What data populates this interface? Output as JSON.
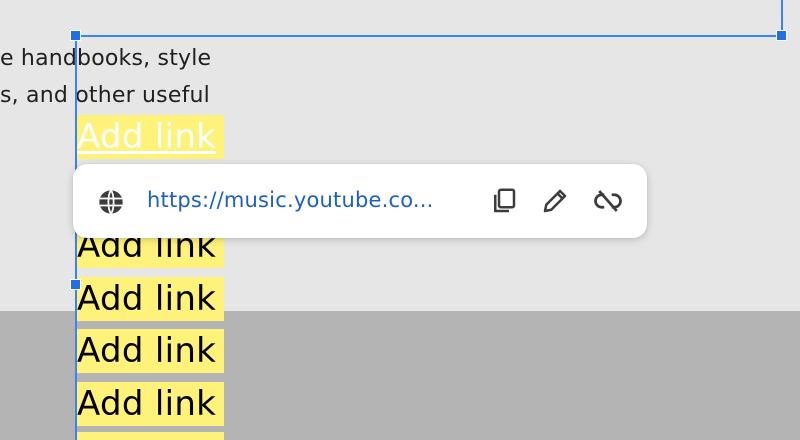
{
  "document": {
    "text_line_1": "e handbooks, style",
    "text_line_2": "s, and other useful",
    "link_items": [
      "Add link",
      "Add link",
      "Add link",
      "Add link",
      "Add link"
    ]
  },
  "link_popup": {
    "url": "https://music.youtube.co...",
    "icons": [
      "globe-icon",
      "copy-icon",
      "edit-icon",
      "unlink-icon"
    ]
  },
  "colors": {
    "highlight": "#fff27a",
    "selection": "#3b82f6",
    "link_text": "#1b5fc7"
  }
}
